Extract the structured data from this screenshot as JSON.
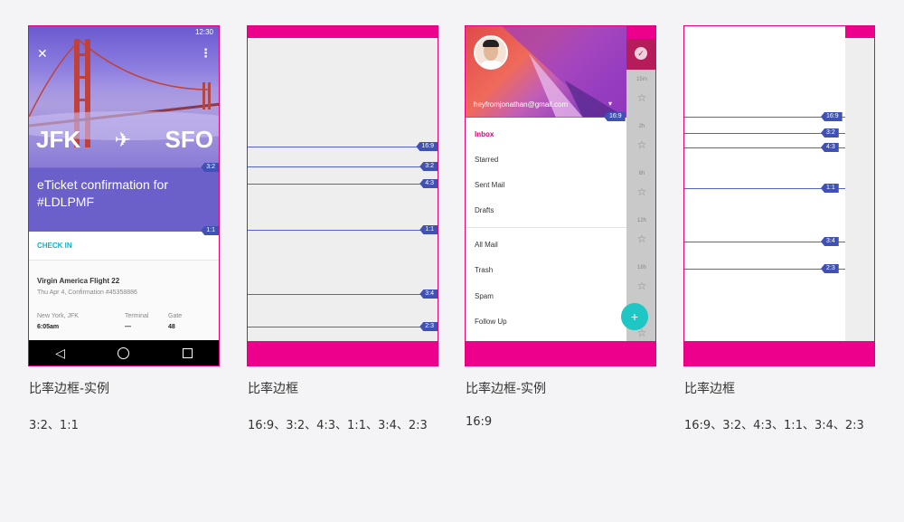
{
  "panels": [
    {
      "caption": "比率边框-实例",
      "ratios": "3:2、1:1",
      "phone": {
        "status_time": "12:30",
        "from": "JFK",
        "to": "SFO",
        "title": "eTicket confirmation for #LDLPMF",
        "checkin": "CHECK IN",
        "flight": "Virgin America Flight 22",
        "flight_sub": "Thu Apr 4, Confirmation #45358886",
        "col1_label": "New York, JFK",
        "col1_value": "6:05am",
        "col2_label": "Terminal",
        "col2_value": "—",
        "col3_label": "Gate",
        "col3_value": "48"
      },
      "tags": [
        "3:2",
        "1:1"
      ]
    },
    {
      "caption": "比率边框",
      "ratios": "16:9、3:2、4:3、1:1、3:4、2:3",
      "tags": [
        "16:9",
        "3:2",
        "4:3",
        "1:1",
        "3:4",
        "2:3"
      ]
    },
    {
      "caption": "比率边框-实例",
      "ratios": "16:9",
      "drawer": {
        "email": "heyfromjonathan@gmail.com",
        "items": [
          "Inbox",
          "Starred",
          "Sent Mail",
          "Drafts",
          "All Mail",
          "Trash",
          "Spam",
          "Follow Up"
        ],
        "times": [
          "15m",
          "2h",
          "6h",
          "12h",
          "18h"
        ]
      },
      "tags": [
        "16:9"
      ]
    },
    {
      "caption": "比率边框",
      "ratios": "16:9、3:2、4:3、1:1、3:4、2:3",
      "tags": [
        "16:9",
        "3:2",
        "4:3",
        "1:1",
        "3:4",
        "2:3"
      ]
    }
  ],
  "colors": {
    "frame_border": "#e0007a",
    "pink_bar": "#ed008c",
    "tag_blue": "#3f51b5",
    "purple": "#6b5fc9",
    "teal": "#10b3c3"
  },
  "icons": [
    "close-icon",
    "more-vert-icon",
    "airplane-icon",
    "back-icon",
    "home-icon",
    "recents-icon",
    "check-icon",
    "star-icon",
    "add-icon",
    "dropdown-caret-icon"
  ]
}
